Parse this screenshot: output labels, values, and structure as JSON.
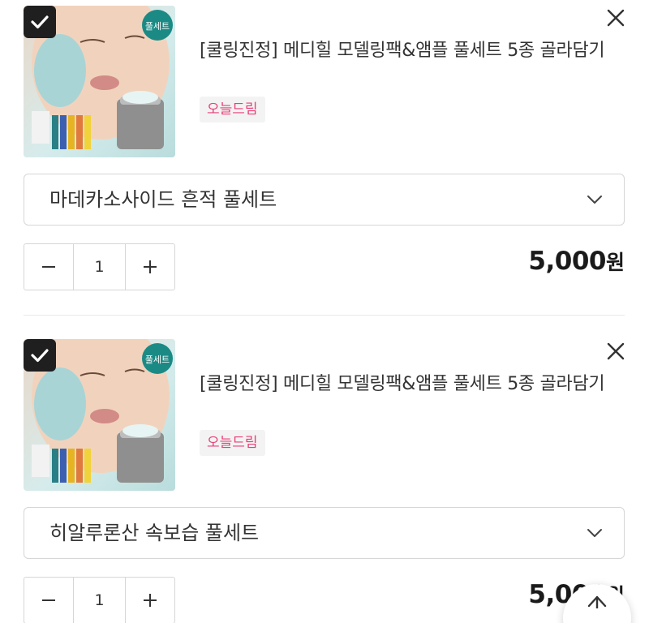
{
  "cart_items": [
    {
      "title": "[쿨링진정] 메디힐 모델링팩&앰플 풀세트 5종 골라담기",
      "badge": "오늘드림",
      "thumb_tag": "풀세트",
      "option": "마데카소사이드 흔적 풀세트",
      "quantity": "1",
      "price": "5,000",
      "currency": "원",
      "checked": true
    },
    {
      "title": "[쿨링진정] 메디힐 모델링팩&앰플 풀세트 5종 골라담기",
      "badge": "오늘드림",
      "thumb_tag": "풀세트",
      "option": "히알루론산 속보습 풀세트",
      "quantity": "1",
      "price": "5,000",
      "currency": "원",
      "checked": true
    }
  ],
  "icons": {
    "checkbox": "check-icon",
    "remove": "close-icon",
    "option_dropdown": "chevron-down-icon",
    "decrease": "minus-icon",
    "increase": "plus-icon",
    "scroll_top": "arrow-up-icon"
  },
  "colors": {
    "badge_text": "#e8407a",
    "badge_bg": "#f3f3f3",
    "checkbox_bg": "#1f1f1f",
    "border": "#d6d6d6"
  }
}
